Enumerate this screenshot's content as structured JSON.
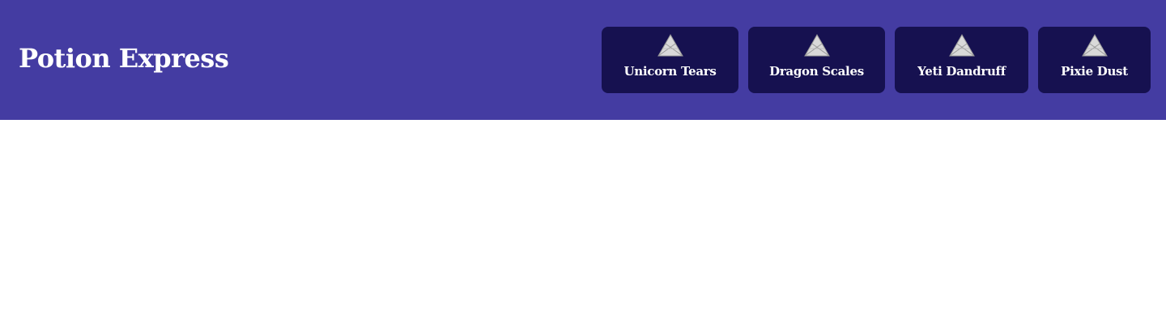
{
  "header": {
    "brand": "Potion Express",
    "background_color": "#443ca2",
    "card_color": "#161150",
    "nav_items": [
      {
        "label": "Unicorn Tears",
        "icon": "broken-image-icon"
      },
      {
        "label": "Dragon Scales",
        "icon": "broken-image-icon"
      },
      {
        "label": "Yeti Dandruff",
        "icon": "broken-image-icon"
      },
      {
        "label": "Pixie Dust",
        "icon": "broken-image-icon"
      }
    ]
  }
}
